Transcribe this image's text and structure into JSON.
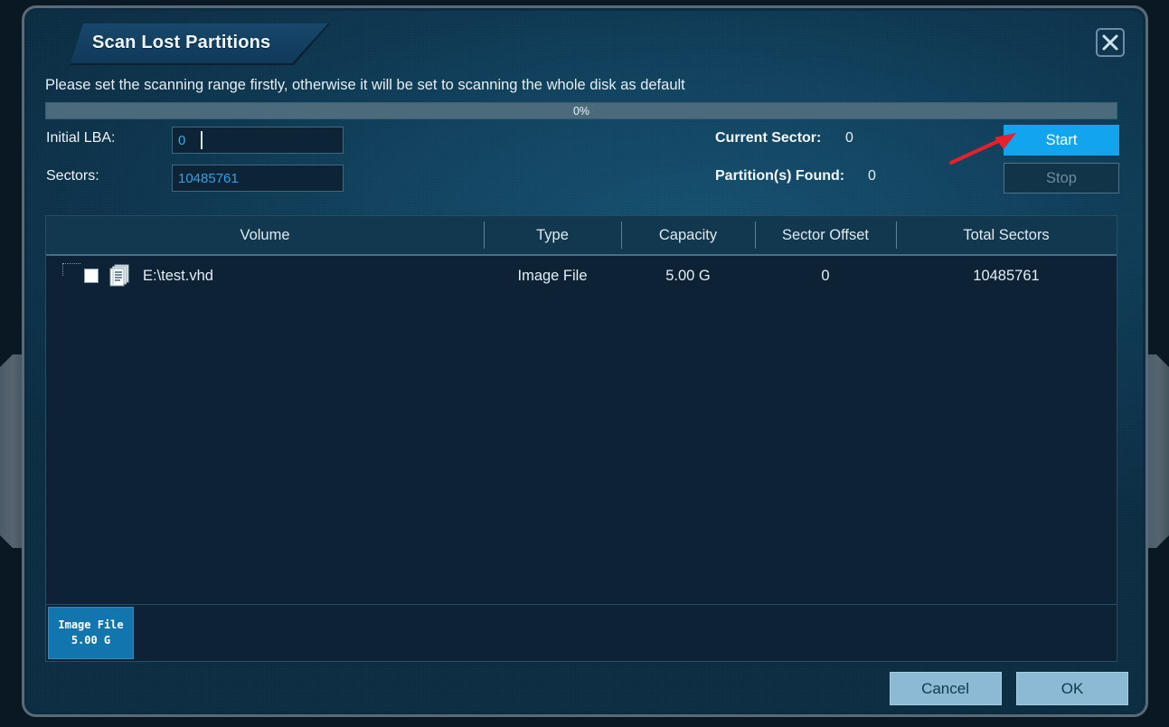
{
  "window": {
    "title": "Scan Lost Partitions",
    "close_icon": "close-icon",
    "instruction": "Please set the scanning range firstly, otherwise it will be set to scanning the whole disk as default"
  },
  "progress": {
    "label": "0%",
    "percent": 0
  },
  "form": {
    "initial_lba_label": "Initial LBA:",
    "initial_lba_value": "0",
    "sectors_label": "Sectors:",
    "sectors_value": "10485761",
    "current_sector_label": "Current Sector:",
    "current_sector_value": "0",
    "partitions_found_label": "Partition(s) Found:",
    "partitions_found_value": "0"
  },
  "actions": {
    "start_label": "Start",
    "stop_label": "Stop",
    "cancel_label": "Cancel",
    "ok_label": "OK"
  },
  "table": {
    "headers": {
      "volume": "Volume",
      "type": "Type",
      "capacity": "Capacity",
      "sector_offset": "Sector Offset",
      "total_sectors": "Total Sectors"
    },
    "rows": [
      {
        "volume": "E:\\test.vhd",
        "type": "Image File",
        "capacity": "5.00 G",
        "sector_offset": "0",
        "total_sectors": "10485761",
        "checked": false,
        "icon": "disk-image-icon"
      }
    ]
  },
  "partition_map": {
    "blocks": [
      {
        "type_label": "Image File",
        "size_label": "5.00 G",
        "color": "#1275ad"
      }
    ]
  },
  "annotation": {
    "arrow_color": "#e8202a",
    "points_to": "start-button"
  },
  "colors": {
    "accent": "#12a5ee",
    "panel_bg": "#0d2335",
    "window_bg": "#124461",
    "footer_button": "#8cb9d3"
  }
}
